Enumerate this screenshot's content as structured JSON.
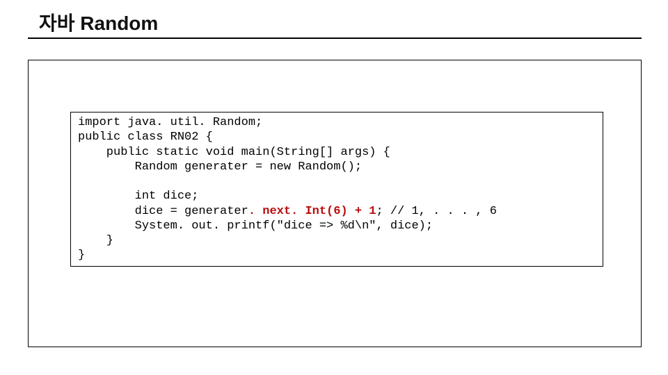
{
  "title": "자바 Random",
  "code": {
    "l1": "import java. util. Random;",
    "l2": "public class RN02 {",
    "l3": "    public static void main(String[] args) {",
    "l4": "        Random generater = new Random();",
    "l5": "",
    "l6": "        int dice;",
    "l7a": "        dice = generater",
    "l7hl": ". next. Int(6) + 1",
    "l7b": "; // 1, . . . , 6",
    "l8": "        System. out. printf(\"dice => %d\\n\", dice);",
    "l9": "    }",
    "l10": "}"
  }
}
